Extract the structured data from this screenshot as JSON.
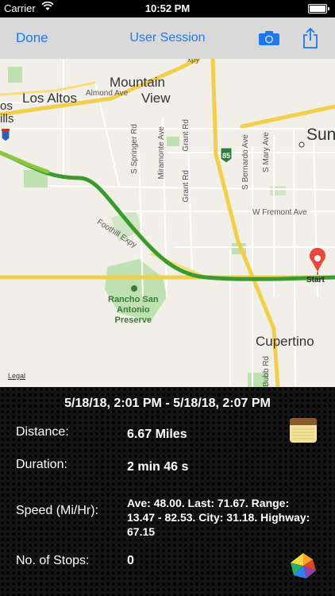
{
  "status": {
    "carrier": "Carrier",
    "time": "10:52 PM"
  },
  "nav": {
    "done_label": "Done",
    "title": "User Session"
  },
  "map": {
    "cities": {
      "los_altos": "Los Altos",
      "mountain_view_1": "Mountain",
      "mountain_view_2": "View",
      "sunnyvale": "Sun",
      "cupertino": "Cupertino",
      "los_altos_hills": "os\nills"
    },
    "streets": {
      "almond": "Almond Ave",
      "springer": "S Springer Rd",
      "miramonte": "Miramonte Ave",
      "grant_rd_1": "Grant Rd",
      "grant_rd_2": "Grant Rd",
      "bernardo": "S Bernardo Ave",
      "mary": "S Mary Ave",
      "fremont": "W Fremont Ave",
      "foothill": "Foothill Expy",
      "bubb": "Bubb Rd",
      "hwy85": "85",
      "xpy": "xpy"
    },
    "park": {
      "line1": "Rancho San",
      "line2": "Antonio",
      "line3": "Preserve"
    },
    "legal": "Legal",
    "start_label": "Start"
  },
  "session": {
    "range": "5/18/18, 2:01 PM - 5/18/18, 2:07 PM",
    "distance_label": "Distance:",
    "distance_value": "6.67 Miles",
    "duration_label": "Duration:",
    "duration_value": "2 min 46 s",
    "speed_label": "Speed (Mi/Hr):",
    "speed_value": "Ave: 48.00. Last: 71.67. Range: 13.47 - 82.53. City: 31.18. Highway: 67.15",
    "stops_label": "No. of Stops:",
    "stops_value": "0"
  },
  "colors": {
    "accent": "#1e78f0",
    "route_green": "#3a9a2e",
    "pin_red": "#e8463a"
  },
  "icons": [
    "wifi-icon",
    "battery-icon",
    "camera-icon",
    "share-icon",
    "notes-icon",
    "photos-icon",
    "map-pin-icon"
  ]
}
